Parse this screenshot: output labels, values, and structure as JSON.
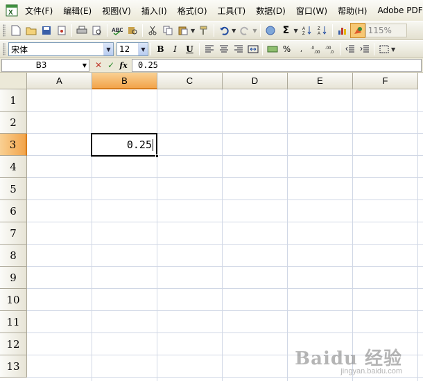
{
  "menubar": {
    "items": [
      "文件(F)",
      "编辑(E)",
      "视图(V)",
      "插入(I)",
      "格式(O)",
      "工具(T)",
      "数据(D)",
      "窗口(W)",
      "帮助(H)",
      "Adobe PDF"
    ]
  },
  "toolbar": {
    "zoom": "115%"
  },
  "format": {
    "font_name": "宋体",
    "font_size": "12",
    "bold_label": "B",
    "italic_label": "I",
    "underline_label": "U",
    "percent_label": "%"
  },
  "formula_bar": {
    "name_box": "B3",
    "cancel_icon": "✕",
    "enter_icon": "✓",
    "fx_label": "fx",
    "value": "0.25"
  },
  "grid": {
    "columns": [
      "A",
      "B",
      "C",
      "D",
      "E",
      "F"
    ],
    "rows": [
      "1",
      "2",
      "3",
      "4",
      "5",
      "6",
      "7",
      "8",
      "9",
      "10",
      "11",
      "12",
      "13"
    ],
    "active_column": "B",
    "active_row": "3",
    "active_cell_value": "0.25"
  },
  "watermark": {
    "text": "Baidu 经验",
    "sub": "jingyan.baidu.com"
  },
  "colors": {
    "active_header": "#f2a44a",
    "gridline": "#d0d7e5",
    "chrome": "#ece9d8"
  }
}
